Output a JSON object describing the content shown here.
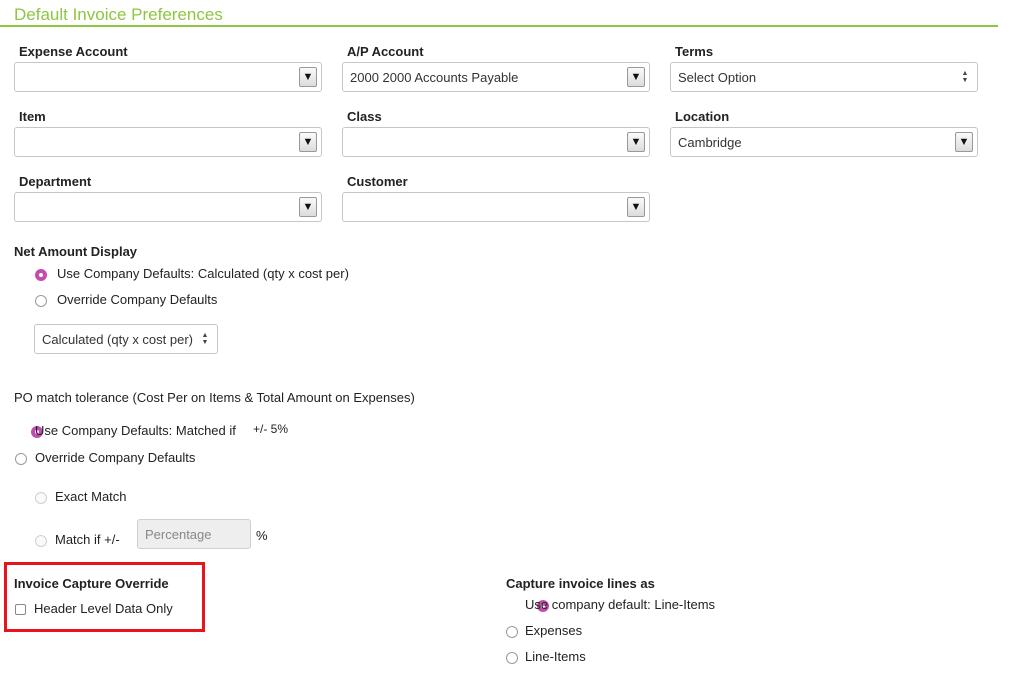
{
  "section": {
    "title": "Default Invoice Preferences"
  },
  "fields": {
    "expense_account": {
      "label": "Expense Account",
      "value": ""
    },
    "ap_account": {
      "label": "A/P Account",
      "value": "2000 2000 Accounts Payable"
    },
    "terms": {
      "label": "Terms",
      "value": "Select Option"
    },
    "item": {
      "label": "Item",
      "value": ""
    },
    "class": {
      "label": "Class",
      "value": ""
    },
    "location": {
      "label": "Location",
      "value": "Cambridge"
    },
    "department": {
      "label": "Department",
      "value": ""
    },
    "customer": {
      "label": "Customer",
      "value": ""
    }
  },
  "net_amount": {
    "label": "Net Amount Display",
    "option_default": "Use Company Defaults: Calculated (qty x cost per)",
    "option_override": "Override Company Defaults",
    "select_value": "Calculated (qty x cost per)"
  },
  "po_match": {
    "label": "PO match tolerance (Cost Per on Items & Total Amount on Expenses)",
    "option_default": "Use Company Defaults: Matched if",
    "default_value": "+/- 5%",
    "option_override": "Override Company Defaults",
    "exact_match": "Exact Match",
    "match_if": "Match if +/-",
    "percentage_placeholder": "Percentage",
    "percent_sign": "%"
  },
  "invoice_capture": {
    "label": "Invoice Capture Override",
    "checkbox_label": "Header Level Data Only"
  },
  "capture_lines": {
    "label": "Capture invoice lines as",
    "option_default": "Use company default: Line-Items",
    "option_expenses": "Expenses",
    "option_line_items": "Line-Items"
  },
  "icons": {
    "dropdown": "▼",
    "up": "▲",
    "down": "▼"
  },
  "colors": {
    "accent_green": "#8dc63f",
    "radio_selected": "#c24dae",
    "highlight_red": "#e8141b"
  }
}
